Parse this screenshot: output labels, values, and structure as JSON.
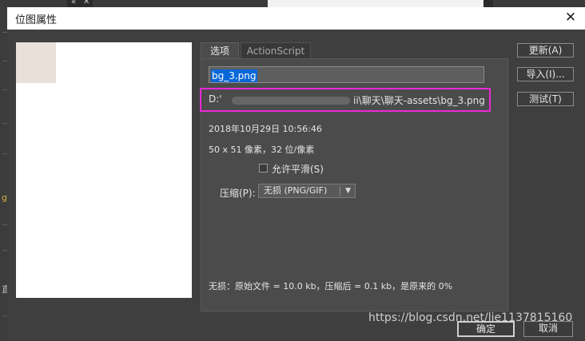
{
  "dialog": {
    "title": "位图属性",
    "close_glyph": "✕"
  },
  "background": {
    "strip_glyphs": [
      "«",
      "✕"
    ],
    "side_chars": [
      "g",
      "直"
    ]
  },
  "tabs": {
    "options": "选项",
    "actionscript": "ActionScript"
  },
  "file": {
    "name": "bg_3.png",
    "path_start": "D:'",
    "path_end": "ii\\聊天\\聊天-assets\\bg_3.png",
    "date": "2018年10月29日  10:56:46",
    "dimensions": "50 x 51 像素，32 位/像素"
  },
  "options": {
    "smoothing_label": "允许平滑(S)",
    "compression_label": "压缩(P):",
    "compression_value": "无损 (PNG/GIF)",
    "summary": "无损：原始文件 = 10.0 kb，压缩后 = 0.1 kb，是原来的 0%"
  },
  "buttons": {
    "update": "更新(A)",
    "import": "导入(I)...",
    "test": "测试(T)",
    "ok": "确定",
    "cancel": "取消"
  },
  "watermark": "https://blog.csdn.net/lie1137815160",
  "colors": {
    "dialog_bg": "#3f3f3f",
    "panel_bg": "#4b4b4b",
    "highlight_border": "#ea29d6",
    "selection": "#0a67d8"
  },
  "icons": {
    "close": "close-icon",
    "dropdown": "chevron-down-icon"
  }
}
